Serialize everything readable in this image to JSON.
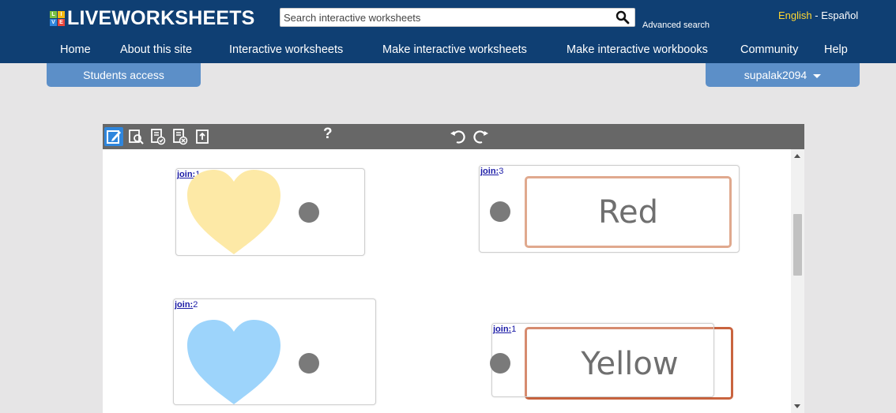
{
  "header": {
    "logo_letters": [
      "L",
      "I",
      "V",
      "E"
    ],
    "logo_text": "LIVEWORKSHEETS",
    "search_placeholder": "Search interactive worksheets",
    "advanced_search": "Advanced search",
    "lang_english": "English",
    "lang_sep": " - ",
    "lang_spanish": "Español"
  },
  "nav": {
    "items": [
      "Home",
      "About this site",
      "Interactive worksheets",
      "Make interactive worksheets",
      "Make interactive workbooks",
      "Community",
      "Help"
    ]
  },
  "tabs": {
    "students": "Students access",
    "user": "supalak2094"
  },
  "toolbar": {
    "help": "?"
  },
  "worksheet": {
    "cards": [
      {
        "join_prefix": "join:",
        "join_num": "1",
        "kind": "heart",
        "color": "#fde9a6"
      },
      {
        "join_prefix": "join:",
        "join_num": "3",
        "kind": "word",
        "word": "Red"
      },
      {
        "join_prefix": "join:",
        "join_num": "2",
        "kind": "heart",
        "color": "#9dd4fb"
      },
      {
        "join_prefix": "join:",
        "join_num": "1",
        "kind": "word",
        "word": "Yellow"
      }
    ]
  },
  "colors": {
    "header_bg": "#0f3f73",
    "tab_bg": "#5c8fc8",
    "toolbar_bg": "#676767",
    "word_border_red": "#e0a98e",
    "word_border_yellow": "#c9643f"
  }
}
